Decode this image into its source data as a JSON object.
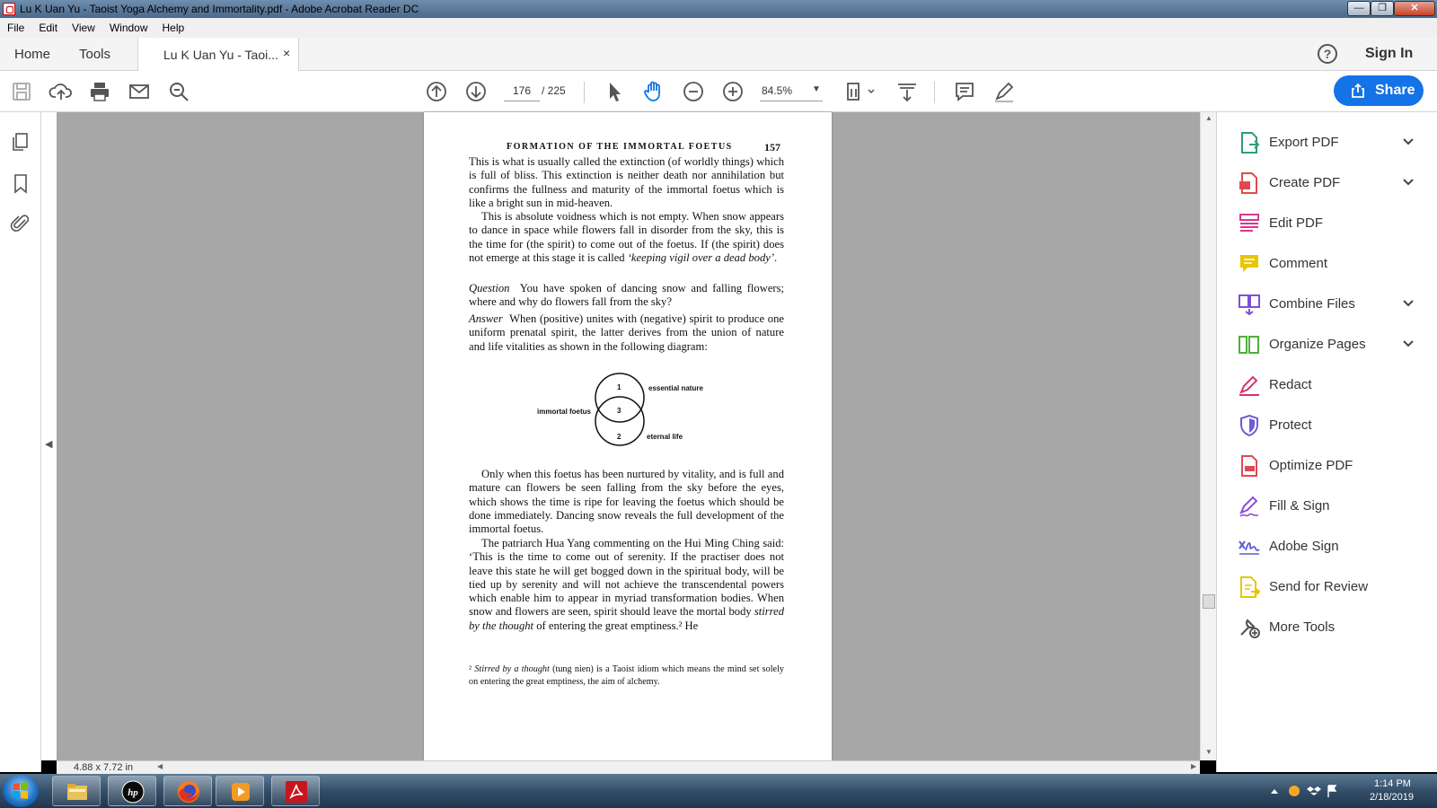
{
  "window": {
    "title": "Lu K Uan Yu - Taoist Yoga Alchemy and Immortality.pdf - Adobe Acrobat Reader DC",
    "min_glyph": "—",
    "max_glyph": "❐",
    "close_glyph": "✕"
  },
  "menu": [
    "File",
    "Edit",
    "View",
    "Window",
    "Help"
  ],
  "tabs": {
    "home": "Home",
    "tools": "Tools",
    "document": "Lu K Uan Yu - Taoi...",
    "close": "×"
  },
  "header": {
    "help": "?",
    "sign_in": "Sign In"
  },
  "toolbar": {
    "page_current": "176",
    "page_total": "/ 225",
    "zoom": "84.5%",
    "share_label": "Share",
    "icons": [
      "save-icon",
      "upload-icon",
      "print-icon",
      "email-icon",
      "search-icon",
      "page-up-icon",
      "page-down-icon",
      "select-cursor-icon",
      "hand-icon",
      "zoom-out-icon",
      "zoom-in-icon",
      "page-layout-icon",
      "scroll-mode-icon",
      "comment-icon",
      "highlight-icon"
    ]
  },
  "colors": {
    "accent": "#1473e6",
    "canvas": "#a7a7a7",
    "page": "#ffffff"
  },
  "status": {
    "page_size": "4.88 x 7.72 in"
  },
  "pdf": {
    "header_title": "FORMATION OF THE IMMORTAL FOETUS",
    "header_page": "157",
    "p1": "This is what is usually called the extinction (of worldly things) which is full of bliss. This extinction is neither death nor annihilation but confirms the fullness and maturity of the immortal foetus which is like a bright sun in mid-heaven.",
    "p2_text": "This is absolute voidness which is not empty. When snow appears to dance in space while flowers fall in disorder from the sky, this is the time for (the spirit) to come out of the foetus. If (the spirit) does not emerge at this stage it is called ",
    "p2_italic": "‘keeping vigil over a dead body’",
    "p2_end": ".",
    "q_label": "Question",
    "q_text": "You have spoken of dancing snow and falling flowers; where and why do flowers fall from the sky?",
    "a_label": "Answer",
    "a_text": "When (positive) unites with (negative) spirit to produce one uniform prenatal spirit, the latter derives from the union of nature and life vitalities as shown in the following diagram:",
    "diagram": {
      "top_num": "1",
      "mid_num": "3",
      "bottom_num": "2",
      "top_label": "essential nature",
      "mid_label": "immortal foetus",
      "bottom_label": "eternal life"
    },
    "p3": "Only when this foetus has been nurtured by vitality, and is full and mature can flowers be seen falling from the sky before the eyes, which shows the time is ripe for leaving the foetus which should be done immediately. Dancing snow reveals the full development of the immortal foetus.",
    "p4_text": "The patriarch Hua Yang commenting on the Hui Ming Ching said: ‘This is the time to come out of serenity. If the practiser does not leave this state he will get bogged down in the spiritual body, will be tied up by serenity and will not achieve the transcendental powers which enable him to appear in myriad transformation bodies. When snow and flowers are seen, spirit should leave the mortal body ",
    "p4_italic": "stirred by the thought",
    "p4_end": " of entering the great emptiness.² He",
    "footnote_mark": "²",
    "footnote_italic": "Stirred by a thought",
    "footnote_text": " (tung nien) is a Taoist idiom which means the mind set solely on entering the great emptiness, the aim of alchemy."
  },
  "tools_pane": [
    {
      "label": "Export PDF",
      "icon": "export-pdf-icon",
      "color": "#2d9d78",
      "chevron": true
    },
    {
      "label": "Create PDF",
      "icon": "create-pdf-icon",
      "color": "#e34850",
      "chevron": true
    },
    {
      "label": "Edit PDF",
      "icon": "edit-pdf-icon",
      "color": "#d83790",
      "chevron": false
    },
    {
      "label": "Comment",
      "icon": "comment-icon",
      "color": "#e8c600",
      "chevron": false
    },
    {
      "label": "Combine Files",
      "icon": "combine-files-icon",
      "color": "#7e4fd6",
      "chevron": true
    },
    {
      "label": "Organize Pages",
      "icon": "organize-pages-icon",
      "color": "#4fae3c",
      "chevron": true
    },
    {
      "label": "Redact",
      "icon": "redact-icon",
      "color": "#d8346b",
      "chevron": false
    },
    {
      "label": "Protect",
      "icon": "protect-icon",
      "color": "#6b5bd6",
      "chevron": false
    },
    {
      "label": "Optimize PDF",
      "icon": "optimize-pdf-icon",
      "color": "#e34850",
      "chevron": false
    },
    {
      "label": "Fill & Sign",
      "icon": "fill-sign-icon",
      "color": "#8a4fd6",
      "chevron": false
    },
    {
      "label": "Adobe Sign",
      "icon": "adobe-sign-icon",
      "color": "#5b5bd6",
      "chevron": false
    },
    {
      "label": "Send for Review",
      "icon": "send-review-icon",
      "color": "#e8c600",
      "chevron": false
    },
    {
      "label": "More Tools",
      "icon": "more-tools-icon",
      "color": "#555555",
      "chevron": false
    }
  ],
  "taskbar": {
    "apps": [
      "file-explorer-icon",
      "hp-icon",
      "firefox-icon",
      "media-player-icon",
      "acrobat-icon"
    ],
    "time": "1:14 PM",
    "date": "2/18/2019"
  }
}
